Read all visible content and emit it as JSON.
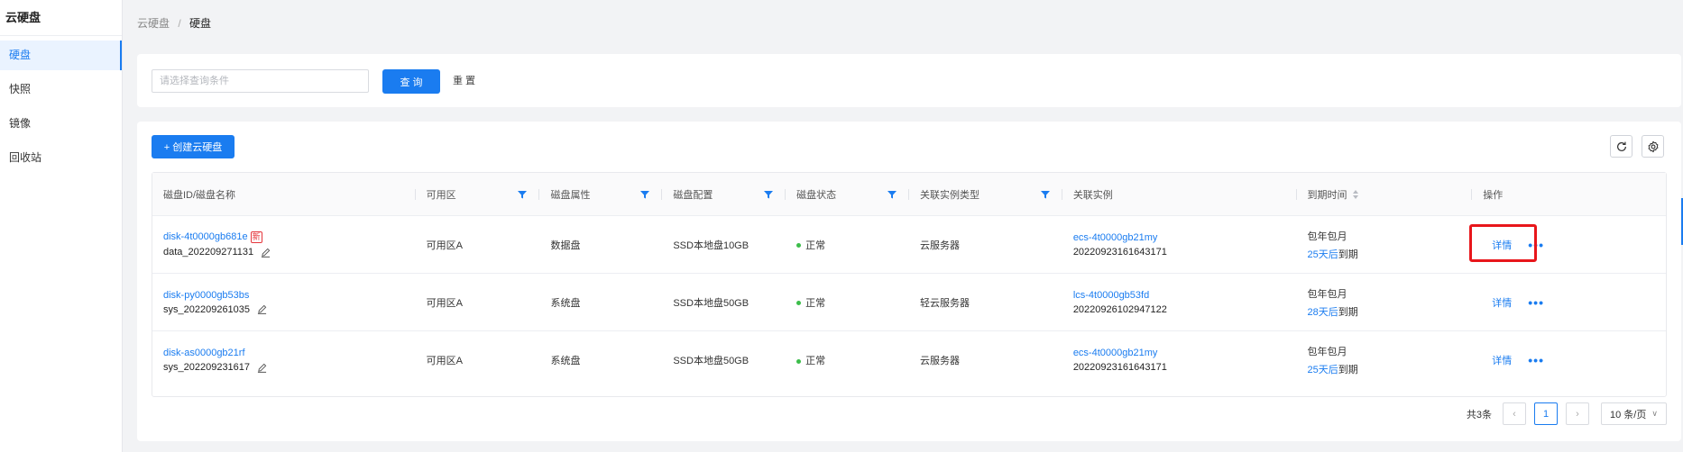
{
  "sidebar": {
    "title": "云硬盘",
    "items": [
      {
        "label": "硬盘",
        "active": true
      },
      {
        "label": "快照",
        "active": false
      },
      {
        "label": "镜像",
        "active": false
      },
      {
        "label": "回收站",
        "active": false
      }
    ]
  },
  "breadcrumb": {
    "parent": "云硬盘",
    "separator": "/",
    "current": "硬盘"
  },
  "search": {
    "placeholder": "请选择查询条件",
    "value": "",
    "query_label": "查 询",
    "reset_label": "重 置"
  },
  "toolbar": {
    "create_label": "+ 创建云硬盘"
  },
  "table": {
    "headers": [
      "磁盘ID/磁盘名称",
      "可用区",
      "磁盘属性",
      "磁盘配置",
      "磁盘状态",
      "关联实例类型",
      "关联实例",
      "到期时间",
      "操作"
    ],
    "rows": [
      {
        "disk_id": "disk-4t0000gb681e",
        "is_new": true,
        "new_label": "新",
        "disk_name": "data_202209271131",
        "zone": "可用区A",
        "attribute": "数据盘",
        "config": "SSD本地盘10GB",
        "status": "正常",
        "instance_type": "云服务器",
        "instance_id": "ecs-4t0000gb21my",
        "instance_sub": "20220923161643171",
        "billing": "包年包月",
        "days_left": "25天后",
        "expire_suffix": "到期",
        "detail": "详情"
      },
      {
        "disk_id": "disk-py0000gb53bs",
        "is_new": false,
        "new_label": "",
        "disk_name": "sys_202209261035",
        "zone": "可用区A",
        "attribute": "系统盘",
        "config": "SSD本地盘50GB",
        "status": "正常",
        "instance_type": "轻云服务器",
        "instance_id": "lcs-4t0000gb53fd",
        "instance_sub": "20220926102947122",
        "billing": "包年包月",
        "days_left": "28天后",
        "expire_suffix": "到期",
        "detail": "详情"
      },
      {
        "disk_id": "disk-as0000gb21rf",
        "is_new": false,
        "new_label": "",
        "disk_name": "sys_202209231617",
        "zone": "可用区A",
        "attribute": "系统盘",
        "config": "SSD本地盘50GB",
        "status": "正常",
        "instance_type": "云服务器",
        "instance_id": "ecs-4t0000gb21my",
        "instance_sub": "20220923161643171",
        "billing": "包年包月",
        "days_left": "25天后",
        "expire_suffix": "到期",
        "detail": "详情"
      }
    ]
  },
  "pagination": {
    "total": "共3条",
    "current_page": "1",
    "page_size": "10 条/页"
  },
  "colors": {
    "accent": "#1a7cf0",
    "status_ok": "#3cbd4a",
    "highlight": "#e8161b",
    "new_badge": "#e5343a"
  }
}
